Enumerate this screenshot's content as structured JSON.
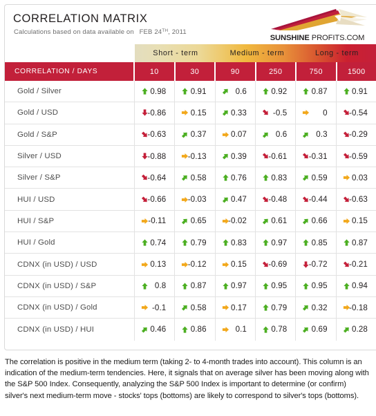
{
  "header": {
    "title": "CORRELATION MATRIX",
    "subtitle_prefix": "Calculations based on data available on",
    "date_main": "FEB 24",
    "date_sup": "TH",
    "date_year": ", 2011"
  },
  "logo": {
    "brand_bold": "SUNSHINE",
    "brand_rest": " PROFITS.COM",
    "colors": {
      "ray_red": "#a8143c",
      "ray_crimson": "#c0203a",
      "ray_gold": "#e0a533",
      "ray_cream": "#efe7cf"
    }
  },
  "table": {
    "corner_label": "CORRELATION / DAYS",
    "term_bands": [
      {
        "label": "Short - term"
      },
      {
        "label": "Medium - term"
      },
      {
        "label": "Long - term"
      }
    ],
    "day_columns": [
      "10",
      "30",
      "90",
      "250",
      "750",
      "1500"
    ],
    "accent_color": "#c2203a",
    "arrow_colors": {
      "up": "#4caf22",
      "up_diag": "#4caf22",
      "flat": "#f2a81b",
      "down_diag": "#c4203a",
      "down": "#c4203a"
    },
    "rows": [
      {
        "label": "Gold / Silver",
        "cells": [
          {
            "value": "0.98",
            "arrow": "up"
          },
          {
            "value": "0.91",
            "arrow": "up"
          },
          {
            "value": "0.6",
            "arrow": "up_diag"
          },
          {
            "value": "0.92",
            "arrow": "up"
          },
          {
            "value": "0.87",
            "arrow": "up"
          },
          {
            "value": "0.91",
            "arrow": "up"
          }
        ]
      },
      {
        "label": "Gold / USD",
        "cells": [
          {
            "value": "-0.86",
            "arrow": "down"
          },
          {
            "value": "0.15",
            "arrow": "flat"
          },
          {
            "value": "0.33",
            "arrow": "up_diag"
          },
          {
            "value": "-0.5",
            "arrow": "down_diag"
          },
          {
            "value": "0",
            "arrow": "flat"
          },
          {
            "value": "-0.54",
            "arrow": "down_diag"
          }
        ]
      },
      {
        "label": "Gold / S&P",
        "cells": [
          {
            "value": "-0.63",
            "arrow": "down_diag"
          },
          {
            "value": "0.37",
            "arrow": "up_diag"
          },
          {
            "value": "0.07",
            "arrow": "flat"
          },
          {
            "value": "0.6",
            "arrow": "up_diag"
          },
          {
            "value": "0.3",
            "arrow": "up_diag"
          },
          {
            "value": "-0.29",
            "arrow": "down_diag"
          }
        ]
      },
      {
        "label": "Silver / USD",
        "cells": [
          {
            "value": "-0.88",
            "arrow": "down"
          },
          {
            "value": "-0.13",
            "arrow": "flat"
          },
          {
            "value": "0.39",
            "arrow": "up_diag"
          },
          {
            "value": "-0.61",
            "arrow": "down_diag"
          },
          {
            "value": "-0.31",
            "arrow": "down_diag"
          },
          {
            "value": "-0.59",
            "arrow": "down_diag"
          }
        ]
      },
      {
        "label": "Silver / S&P",
        "cells": [
          {
            "value": "-0.64",
            "arrow": "down_diag"
          },
          {
            "value": "0.58",
            "arrow": "up_diag"
          },
          {
            "value": "0.76",
            "arrow": "up"
          },
          {
            "value": "0.83",
            "arrow": "up"
          },
          {
            "value": "0.59",
            "arrow": "up_diag"
          },
          {
            "value": "0.03",
            "arrow": "flat"
          }
        ]
      },
      {
        "label": "HUI / USD",
        "cells": [
          {
            "value": "-0.66",
            "arrow": "down_diag"
          },
          {
            "value": "-0.03",
            "arrow": "flat"
          },
          {
            "value": "0.47",
            "arrow": "up_diag"
          },
          {
            "value": "-0.48",
            "arrow": "down_diag"
          },
          {
            "value": "-0.44",
            "arrow": "down_diag"
          },
          {
            "value": "-0.63",
            "arrow": "down_diag"
          }
        ]
      },
      {
        "label": "HUI / S&P",
        "cells": [
          {
            "value": "-0.11",
            "arrow": "flat"
          },
          {
            "value": "0.65",
            "arrow": "up_diag"
          },
          {
            "value": "-0.02",
            "arrow": "flat"
          },
          {
            "value": "0.61",
            "arrow": "up_diag"
          },
          {
            "value": "0.66",
            "arrow": "up_diag"
          },
          {
            "value": "0.15",
            "arrow": "flat"
          }
        ]
      },
      {
        "label": "HUI / Gold",
        "cells": [
          {
            "value": "0.74",
            "arrow": "up"
          },
          {
            "value": "0.79",
            "arrow": "up"
          },
          {
            "value": "0.83",
            "arrow": "up"
          },
          {
            "value": "0.97",
            "arrow": "up"
          },
          {
            "value": "0.85",
            "arrow": "up"
          },
          {
            "value": "0.87",
            "arrow": "up"
          }
        ]
      },
      {
        "label": "CDNX (in USD) / USD",
        "cells": [
          {
            "value": "0.13",
            "arrow": "flat"
          },
          {
            "value": "-0.12",
            "arrow": "flat"
          },
          {
            "value": "0.15",
            "arrow": "flat"
          },
          {
            "value": "-0.69",
            "arrow": "down_diag"
          },
          {
            "value": "-0.72",
            "arrow": "down"
          },
          {
            "value": "-0.21",
            "arrow": "down_diag"
          }
        ]
      },
      {
        "label": "CDNX (in USD) / S&P",
        "cells": [
          {
            "value": "0.8",
            "arrow": "up"
          },
          {
            "value": "0.87",
            "arrow": "up"
          },
          {
            "value": "0.97",
            "arrow": "up"
          },
          {
            "value": "0.95",
            "arrow": "up"
          },
          {
            "value": "0.95",
            "arrow": "up"
          },
          {
            "value": "0.94",
            "arrow": "up"
          }
        ]
      },
      {
        "label": "CDNX (in USD) / Gold",
        "cells": [
          {
            "value": "-0.1",
            "arrow": "flat"
          },
          {
            "value": "0.58",
            "arrow": "up_diag"
          },
          {
            "value": "0.17",
            "arrow": "flat"
          },
          {
            "value": "0.79",
            "arrow": "up"
          },
          {
            "value": "0.32",
            "arrow": "up_diag"
          },
          {
            "value": "-0.18",
            "arrow": "flat"
          }
        ]
      },
      {
        "label": "CDNX (in USD) / HUI",
        "cells": [
          {
            "value": "0.46",
            "arrow": "up_diag"
          },
          {
            "value": "0.86",
            "arrow": "up"
          },
          {
            "value": "0.1",
            "arrow": "flat"
          },
          {
            "value": "0.78",
            "arrow": "up"
          },
          {
            "value": "0.69",
            "arrow": "up_diag"
          },
          {
            "value": "0.28",
            "arrow": "up_diag"
          }
        ]
      }
    ]
  },
  "note": {
    "text": "The correlation is positive in the medium term (taking 2- to 4-month trades into account). This column is an indication of the medium-term tendencies. Here, it signals that on average silver has been moving along with the S&P 500 Index. Consequently, analyzing the S&P 500 Index is important to determine (or confirm) silver's next medium-term move - stocks' tops (bottoms) are likely to correspond to silver's tops (bottoms)."
  }
}
